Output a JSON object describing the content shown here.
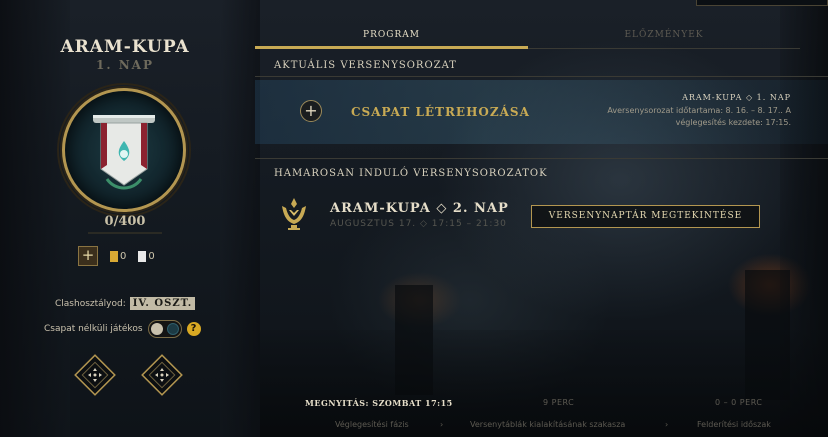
{
  "event": {
    "title": "ARAM-KUPA",
    "subtitle": "1. NAP",
    "points": "0/400"
  },
  "currencies": {
    "add_label": "+",
    "gold_value": "0",
    "white_value": "0"
  },
  "player": {
    "tier_label": "Clashosztályod:",
    "tier_value": "IV. OSZT.",
    "solo_label": "Csapat nélküli játékos",
    "help_symbol": "?"
  },
  "tabs": {
    "schedule": "PROGRAM",
    "history": "ELŐZMÉNYEK"
  },
  "active": {
    "section_title": "AKTUÁLIS VERSENYSOROZAT",
    "plus_symbol": "+",
    "create_team": "CSAPAT LÉTREHOZÁSA",
    "info_title": "ARAM-KUPA ◇ 1. NAP",
    "info_line1": "Aversenysorozat időtartama: 8. 16. – 8. 17.. A",
    "info_line2": "véglegesítés kezdete: 17:15."
  },
  "upcoming": {
    "section_title": "HAMAROSAN INDULÓ VERSENYSOROZATOK",
    "name": "ARAM-KUPA ◇ 2. NAP",
    "time": "AUGUSZTUS 17. ◇ 17:15 – 21:30",
    "calendar_button": "VERSENYNAPTÁR MEGTEKINTÉSE"
  },
  "timeline": {
    "opening": "MEGNYITÁS: SZOMBAT 17:15",
    "nine_min": "9 PERC",
    "zero_min": "0 – 0 PERC",
    "phase1": "Véglegesítési fázis",
    "phase2": "Versenytáblák kialakításának szakasza",
    "phase3": "Felderítési időszak",
    "arrow": "›"
  },
  "colors": {
    "accent_gold": "#c8aa54",
    "help_yellow": "#d9a923",
    "text_light": "#e6dec9",
    "text_dim": "#5d5a52"
  },
  "icons": {
    "trophy": "trophy-banner-icon",
    "upcoming": "tournament-icon",
    "logo_slot": "team-logo-slot-icon"
  }
}
